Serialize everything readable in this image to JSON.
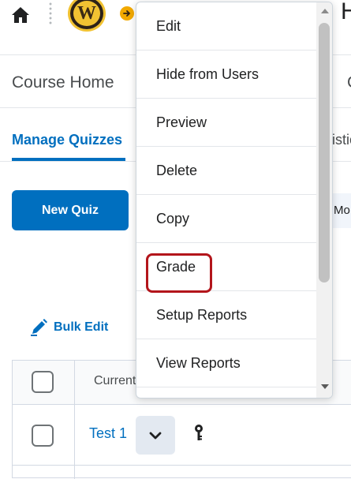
{
  "header": {
    "logo_letter": "W",
    "title_partial": "H",
    "icons": [
      "home-icon",
      "arrow-right-circle-icon"
    ]
  },
  "nav": {
    "course_home": "Course Home",
    "next_partial": "C"
  },
  "tabs": {
    "manage_quizzes": "Manage Quizzes",
    "next_partial": "istic"
  },
  "toolbar": {
    "new_quiz": "New Quiz",
    "more_partial": "Mo",
    "bulk_edit": "Bulk Edit"
  },
  "table": {
    "header_current": "Current",
    "rows": [
      {
        "name": "Test 1"
      }
    ]
  },
  "menu": {
    "items": [
      "Edit",
      "Hide from Users",
      "Preview",
      "Delete",
      "Copy",
      "Grade",
      "Setup Reports",
      "View Reports"
    ],
    "highlighted": "Grade"
  },
  "colors": {
    "accent": "#006fbf",
    "highlight_border": "#b3151b",
    "logo_gold": "#f1c232"
  }
}
